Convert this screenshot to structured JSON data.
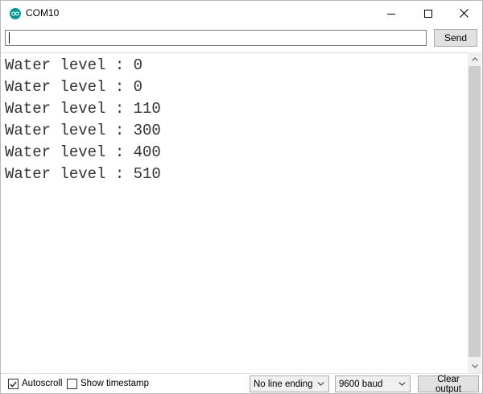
{
  "window": {
    "title": "COM10"
  },
  "send": {
    "input_value": "",
    "button_label": "Send"
  },
  "output": {
    "lines": [
      "Water level : 0",
      "Water level : 0",
      "Water level : 110",
      "Water level : 300",
      "Water level : 400",
      "Water level : 510"
    ]
  },
  "bottom": {
    "autoscroll_label": "Autoscroll",
    "autoscroll_checked": true,
    "timestamp_label": "Show timestamp",
    "timestamp_checked": false,
    "line_ending": "No line ending",
    "baud": "9600 baud",
    "clear_label": "Clear output"
  },
  "icons": {
    "app": "arduino-icon",
    "minimize": "minimize-icon",
    "maximize": "maximize-icon",
    "close": "close-icon"
  },
  "colors": {
    "accent": "#00979c"
  }
}
